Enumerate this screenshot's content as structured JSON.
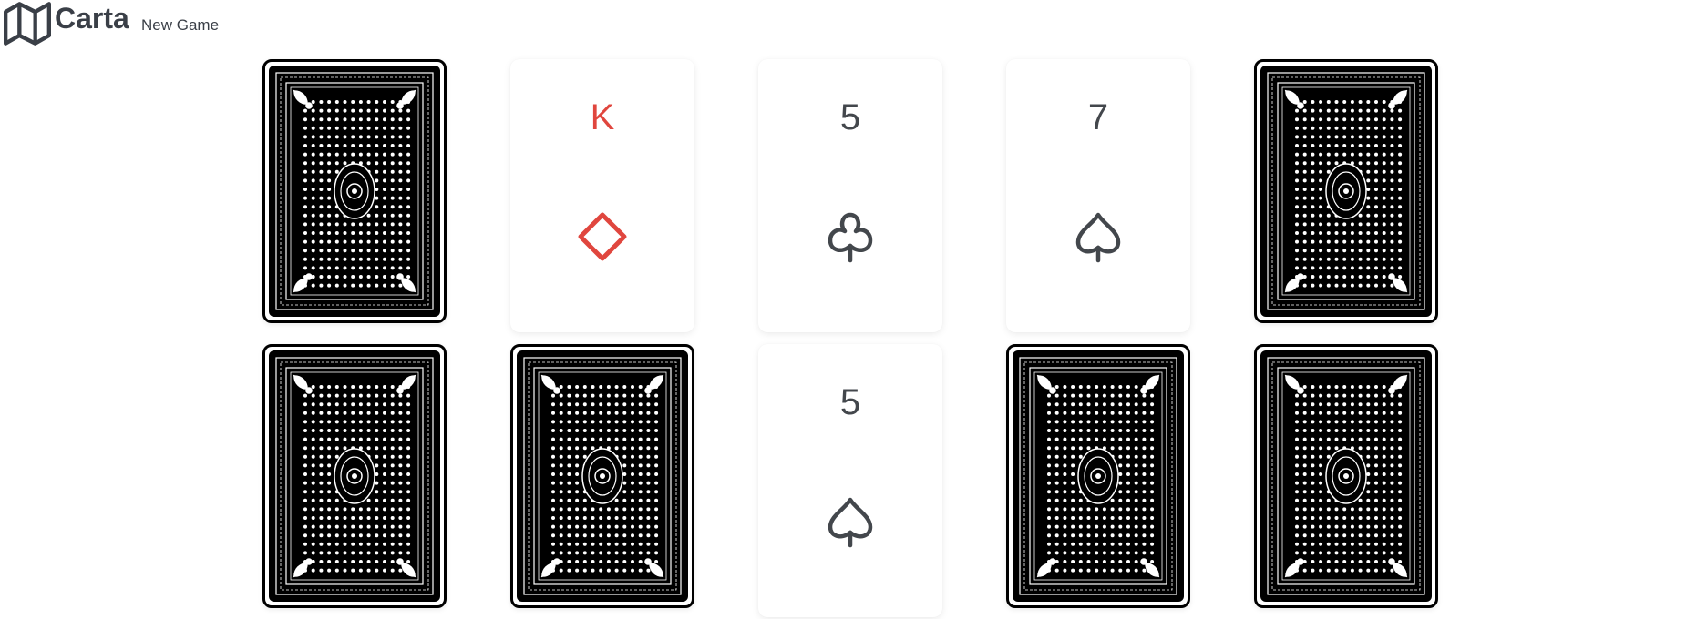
{
  "header": {
    "brand": "Carta",
    "new_game_label": "New Game",
    "logo_icon": "map-icon"
  },
  "colors": {
    "red_suit": "#e0463e",
    "dark_suit": "#43474c",
    "card_back": "#000000"
  },
  "cards": [
    {
      "state": "face-down"
    },
    {
      "state": "face-up",
      "rank": "K",
      "suit": "diamonds",
      "color": "red"
    },
    {
      "state": "face-up",
      "rank": "5",
      "suit": "clubs",
      "color": "dark"
    },
    {
      "state": "face-up",
      "rank": "7",
      "suit": "spades",
      "color": "dark"
    },
    {
      "state": "face-down"
    },
    {
      "state": "face-down"
    },
    {
      "state": "face-down"
    },
    {
      "state": "face-up",
      "rank": "5",
      "suit": "spades",
      "color": "dark"
    },
    {
      "state": "face-down"
    },
    {
      "state": "face-down"
    }
  ]
}
